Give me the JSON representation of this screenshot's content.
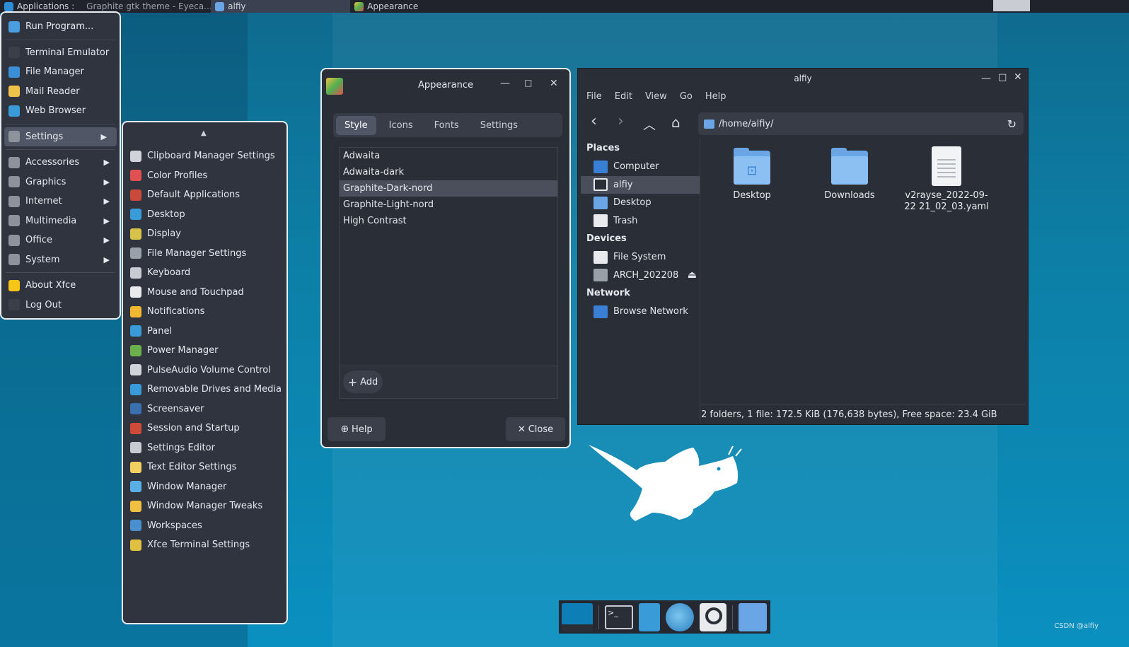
{
  "topbar": {
    "items": [
      {
        "label": "Applications :"
      },
      {
        "label": "Graphite gtk theme - Eyeca…"
      },
      {
        "label": "alfiy"
      },
      {
        "label": "Appearance"
      }
    ]
  },
  "app_menu": {
    "items": [
      {
        "label": "Run Program...",
        "icon": "search-icon",
        "color": "#4a9fe0"
      },
      {
        "label": "Terminal Emulator",
        "icon": "terminal-icon",
        "color": "#3a3f48"
      },
      {
        "label": "File Manager",
        "icon": "file-manager-icon",
        "color": "#3b8fd6"
      },
      {
        "label": "Mail Reader",
        "icon": "mail-icon",
        "color": "#f0c24a"
      },
      {
        "label": "Web Browser",
        "icon": "globe-icon",
        "color": "#3a9bd9"
      },
      {
        "label": "Settings",
        "icon": "settings-icon",
        "color": "#8d929b",
        "submenu": true
      },
      {
        "label": "Accessories",
        "icon": "accessories-icon",
        "color": "#8d929b",
        "submenu": true
      },
      {
        "label": "Graphics",
        "icon": "graphics-icon",
        "color": "#8d929b",
        "submenu": true
      },
      {
        "label": "Internet",
        "icon": "internet-icon",
        "color": "#8d929b",
        "submenu": true
      },
      {
        "label": "Multimedia",
        "icon": "multimedia-icon",
        "color": "#8d929b",
        "submenu": true
      },
      {
        "label": "Office",
        "icon": "office-icon",
        "color": "#8d929b",
        "submenu": true
      },
      {
        "label": "System",
        "icon": "gear-icon",
        "color": "#8d929b",
        "submenu": true
      },
      {
        "label": "About Xfce",
        "icon": "star-icon",
        "color": "#f5c518"
      },
      {
        "label": "Log Out",
        "icon": "logout-icon",
        "color": "#3a3f48"
      }
    ]
  },
  "settings_menu": {
    "items": [
      {
        "label": "Clipboard Manager Settings",
        "color": "#d0d4da"
      },
      {
        "label": "Color Profiles",
        "color": "#e05050"
      },
      {
        "label": "Default Applications",
        "color": "#c94a3a"
      },
      {
        "label": "Desktop",
        "color": "#3a9bd9"
      },
      {
        "label": "Display",
        "color": "#d7c34a"
      },
      {
        "label": "File Manager Settings",
        "color": "#9aa0a8"
      },
      {
        "label": "Keyboard",
        "color": "#c8ccd2"
      },
      {
        "label": "Mouse and Touchpad",
        "color": "#e8eaee"
      },
      {
        "label": "Notifications",
        "color": "#f0b830"
      },
      {
        "label": "Panel",
        "color": "#3a9bd9"
      },
      {
        "label": "Power Manager",
        "color": "#6ab04c"
      },
      {
        "label": "PulseAudio Volume Control",
        "color": "#d0d4da"
      },
      {
        "label": "Removable Drives and Media",
        "color": "#3a9bd9"
      },
      {
        "label": "Screensaver",
        "color": "#3a6fb0"
      },
      {
        "label": "Session and Startup",
        "color": "#d04a3a"
      },
      {
        "label": "Settings Editor",
        "color": "#c8ccd2"
      },
      {
        "label": "Text Editor Settings",
        "color": "#f0d060"
      },
      {
        "label": "Window Manager",
        "color": "#5aaee6"
      },
      {
        "label": "Window Manager Tweaks",
        "color": "#f0c040"
      },
      {
        "label": "Workspaces",
        "color": "#4a8fd0"
      },
      {
        "label": "Xfce Terminal Settings",
        "color": "#e0c040"
      }
    ]
  },
  "appearance": {
    "title": "Appearance",
    "tabs": [
      {
        "label": "Style"
      },
      {
        "label": "Icons"
      },
      {
        "label": "Fonts"
      },
      {
        "label": "Settings"
      }
    ],
    "themes": [
      {
        "label": "Adwaita"
      },
      {
        "label": "Adwaita-dark"
      },
      {
        "label": "Graphite-Dark-nord"
      },
      {
        "label": "Graphite-Light-nord"
      },
      {
        "label": "High Contrast"
      }
    ],
    "selected_theme": "Graphite-Dark-nord",
    "add_label": "Add",
    "help_label": "Help",
    "close_label": "Close"
  },
  "file_manager": {
    "title": "alfiy",
    "menu": [
      {
        "label": "File"
      },
      {
        "label": "Edit"
      },
      {
        "label": "View"
      },
      {
        "label": "Go"
      },
      {
        "label": "Help"
      }
    ],
    "path": "/home/alfiy/",
    "sections": {
      "places": "Places",
      "devices": "Devices",
      "network": "Network"
    },
    "places": [
      {
        "label": "Computer",
        "color": "#3a7fd6"
      },
      {
        "label": "alfiy",
        "color": "#2a2e36"
      },
      {
        "label": "Desktop",
        "color": "#6aa5e6"
      },
      {
        "label": "Trash",
        "color": "#e8eaee"
      }
    ],
    "devices": [
      {
        "label": "File System",
        "color": "#e8eaee"
      },
      {
        "label": "ARCH_202208",
        "color": "#9aa0a8"
      }
    ],
    "network": [
      {
        "label": "Browse Network",
        "color": "#3a7fd6"
      }
    ],
    "files": [
      {
        "label": "Desktop",
        "type": "folder"
      },
      {
        "label": "Downloads",
        "type": "folder"
      },
      {
        "label": "v2rayse_2022-09-22 21_02_03.yaml",
        "type": "file"
      }
    ],
    "status": "2 folders, 1 file: 172.5 KiB (176,638 bytes), Free space: 23.4 GiB"
  },
  "watermark": "CSDN @alfiy"
}
